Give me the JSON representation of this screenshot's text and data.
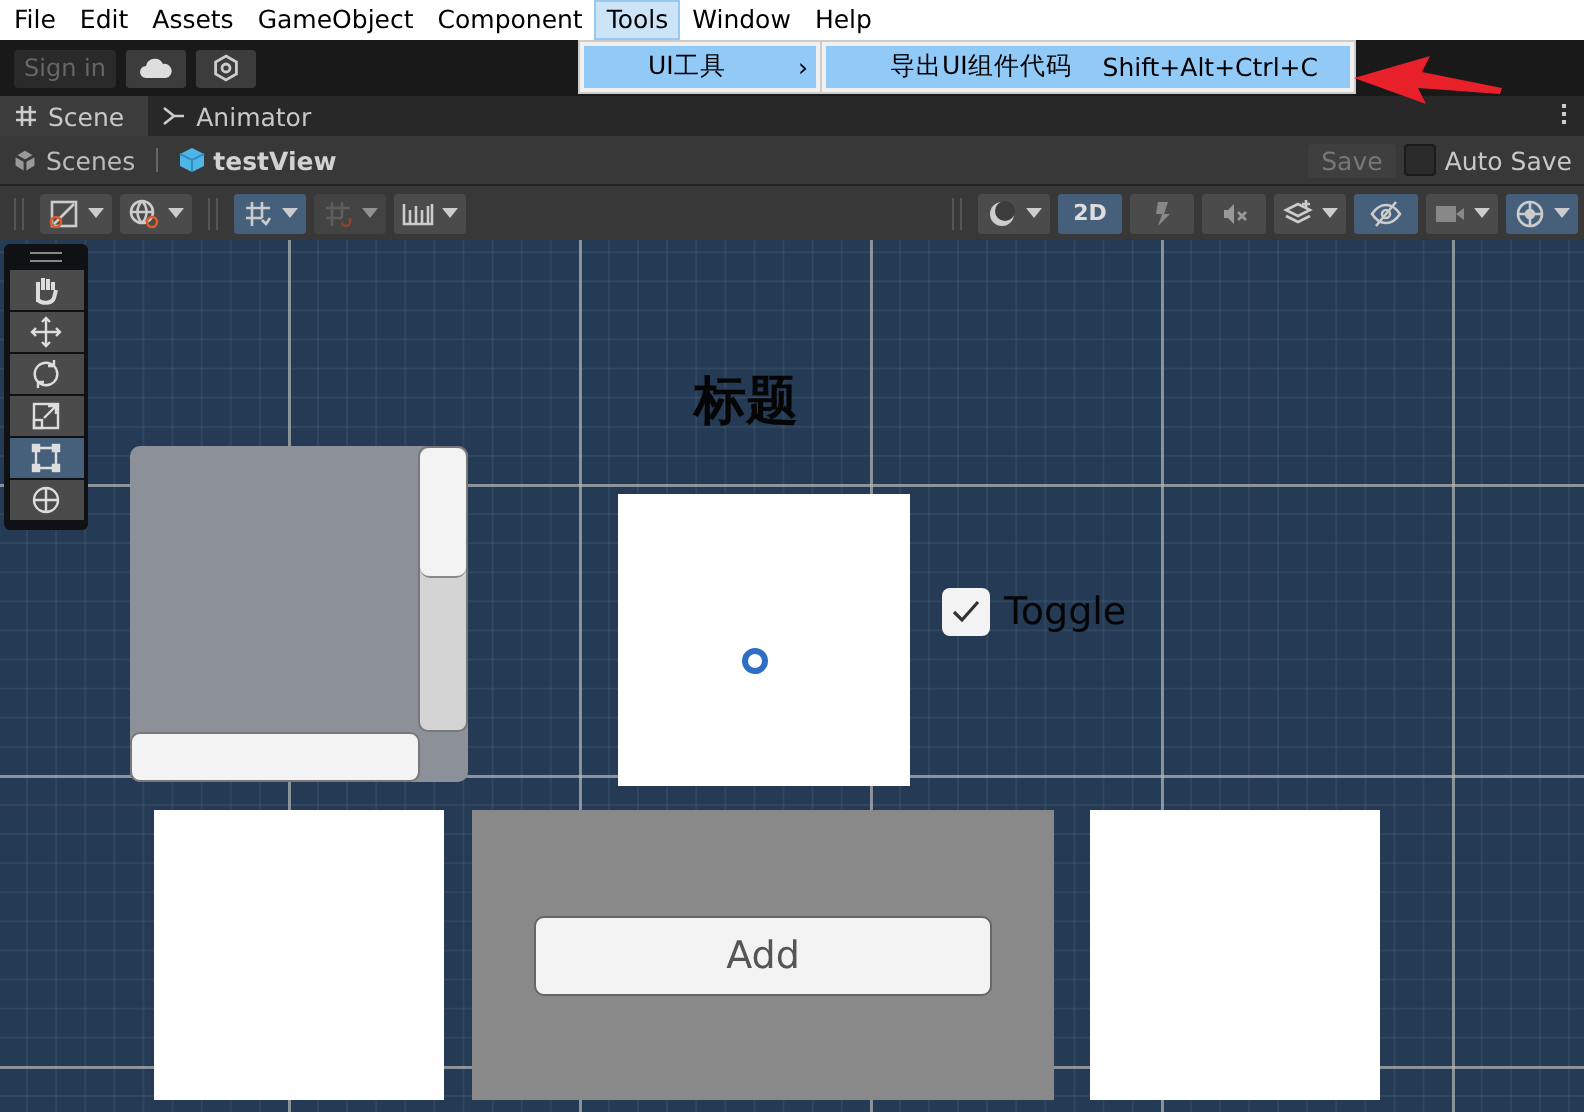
{
  "menu_bar": [
    {
      "label": "File",
      "selected": false
    },
    {
      "label": "Edit",
      "selected": false
    },
    {
      "label": "Assets",
      "selected": false
    },
    {
      "label": "GameObject",
      "selected": false
    },
    {
      "label": "Component",
      "selected": false
    },
    {
      "label": "Tools",
      "selected": true
    },
    {
      "label": "Window",
      "selected": false
    },
    {
      "label": "Help",
      "selected": false
    }
  ],
  "tools_menu": {
    "items": [
      {
        "label": "UI工具",
        "arrow": "›",
        "selected": true
      }
    ],
    "submenu": [
      {
        "label": "导出UI组件代码",
        "shortcut": "Shift+Alt+Ctrl+C",
        "selected": true
      }
    ]
  },
  "account_bar": {
    "sign_in": "Sign in"
  },
  "tabs": [
    {
      "label": "Scene",
      "kind": "scene",
      "selected": true
    },
    {
      "label": "Animator",
      "kind": "animator",
      "selected": false
    }
  ],
  "breadcrumb": {
    "root": "Scenes",
    "current": "testView"
  },
  "save": {
    "label": "Save",
    "disabled": true
  },
  "auto_save": {
    "label": "Auto Save",
    "checked": false
  },
  "scene_toolbar": {
    "left": [
      {
        "kind": "rect",
        "selected": false,
        "dropdown": true,
        "disabled": false
      },
      {
        "kind": "globe",
        "selected": false,
        "dropdown": true,
        "disabled": false
      },
      {
        "kind": "grid",
        "selected": true,
        "dropdown": true,
        "disabled": false
      },
      {
        "kind": "snap",
        "selected": false,
        "dropdown": true,
        "disabled": true
      },
      {
        "kind": "ruler",
        "selected": false,
        "dropdown": true,
        "disabled": false
      }
    ],
    "right": [
      {
        "kind": "shading",
        "selected": false,
        "dropdown": true,
        "disabled": false
      },
      {
        "kind": "dimension",
        "label": "2D",
        "selected": true,
        "dropdown": false,
        "disabled": false
      },
      {
        "kind": "light",
        "selected": false,
        "dropdown": false,
        "disabled": false
      },
      {
        "kind": "audio",
        "selected": false,
        "dropdown": false,
        "disabled": false
      },
      {
        "kind": "fx",
        "selected": false,
        "dropdown": true,
        "disabled": false
      },
      {
        "kind": "visibility",
        "selected": true,
        "dropdown": false,
        "disabled": false
      },
      {
        "kind": "camera",
        "selected": false,
        "dropdown": true,
        "disabled": false
      },
      {
        "kind": "gizmo",
        "selected": true,
        "dropdown": true,
        "disabled": false
      }
    ]
  },
  "tool_palette": [
    {
      "kind": "hand",
      "selected": false
    },
    {
      "kind": "move",
      "selected": false
    },
    {
      "kind": "rotate",
      "selected": false
    },
    {
      "kind": "scale",
      "selected": false
    },
    {
      "kind": "rect",
      "selected": true
    },
    {
      "kind": "transform",
      "selected": false
    }
  ],
  "scene": {
    "title": "标题",
    "toggle": {
      "label": "Toggle",
      "checked": true
    },
    "button": {
      "label": "Add"
    }
  }
}
